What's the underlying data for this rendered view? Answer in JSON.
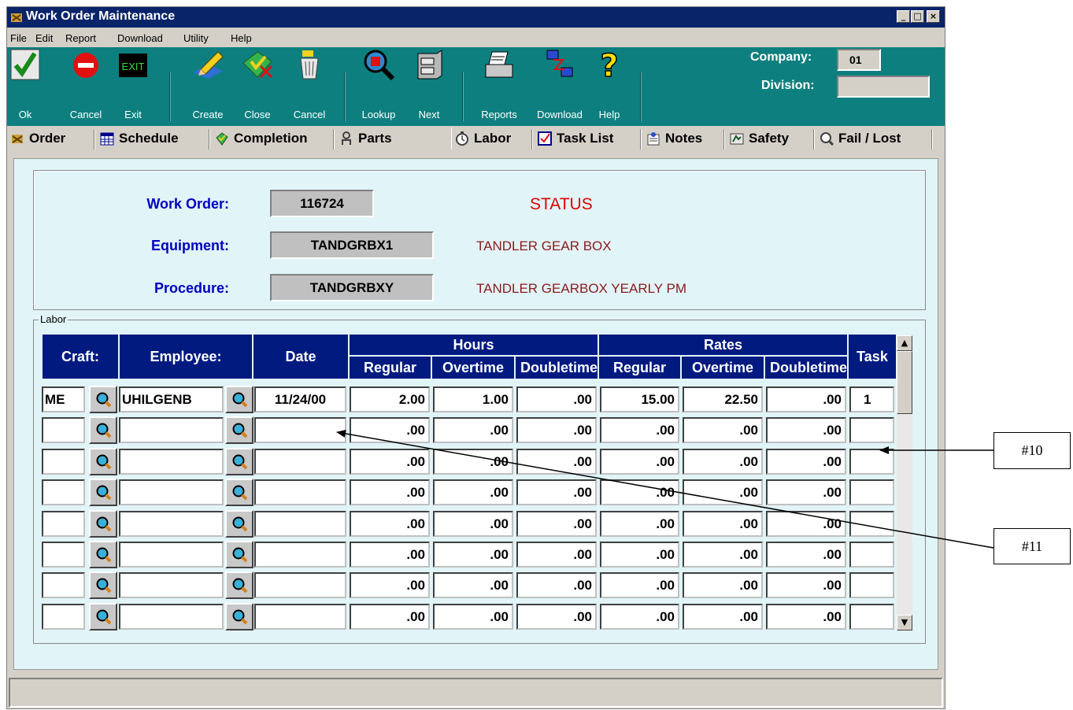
{
  "window": {
    "title": "Work Order Maintenance",
    "minimize": "_",
    "maximize": "□",
    "close": "×"
  },
  "menu": [
    "File",
    "Edit",
    "Report",
    "Download",
    "Utility",
    "Help"
  ],
  "toolbar": {
    "ok": "Ok",
    "cancel": "Cancel",
    "exit": "Exit",
    "exit_icon_text": "EXIT",
    "create": "Create",
    "close": "Close",
    "cancel2": "Cancel",
    "lookup": "Lookup",
    "next": "Next",
    "reports": "Reports",
    "download": "Download",
    "help": "Help",
    "company_label": "Company:",
    "company_value": "01",
    "division_label": "Division:",
    "division_value": ""
  },
  "tabs": [
    "Order",
    "Schedule",
    "Completion",
    "Parts",
    "Labor",
    "Task List",
    "Notes",
    "Safety",
    "Fail / Lost"
  ],
  "active_tab": "Labor",
  "header": {
    "work_order_label": "Work Order:",
    "work_order": "116724",
    "status": "STATUS",
    "equipment_label": "Equipment:",
    "equipment": "TANDGRBX1",
    "equipment_desc": "TANDLER GEAR BOX",
    "procedure_label": "Procedure:",
    "procedure": "TANDGRBXY",
    "procedure_desc": "TANDLER GEARBOX YEARLY PM"
  },
  "labor": {
    "group_title": "Labor",
    "headers": {
      "craft": "Craft:",
      "employee": "Employee:",
      "date": "Date",
      "task": "Task",
      "hours": "Hours",
      "rates": "Rates",
      "regular": "Regular",
      "overtime": "Overtime",
      "doubletime": "Doubletime"
    },
    "rows": [
      {
        "craft": "ME",
        "employee": "UHILGENB",
        "date": "11/24/00",
        "h_reg": "2.00",
        "h_ot": "1.00",
        "h_dt": ".00",
        "r_reg": "15.00",
        "r_ot": "22.50",
        "r_dt": ".00",
        "task": "1"
      },
      {
        "craft": "",
        "employee": "",
        "date": "",
        "h_reg": ".00",
        "h_ot": ".00",
        "h_dt": ".00",
        "r_reg": ".00",
        "r_ot": ".00",
        "r_dt": ".00",
        "task": ""
      },
      {
        "craft": "",
        "employee": "",
        "date": "",
        "h_reg": ".00",
        "h_ot": ".00",
        "h_dt": ".00",
        "r_reg": ".00",
        "r_ot": ".00",
        "r_dt": ".00",
        "task": ""
      },
      {
        "craft": "",
        "employee": "",
        "date": "",
        "h_reg": ".00",
        "h_ot": ".00",
        "h_dt": ".00",
        "r_reg": ".00",
        "r_ot": ".00",
        "r_dt": ".00",
        "task": ""
      },
      {
        "craft": "",
        "employee": "",
        "date": "",
        "h_reg": ".00",
        "h_ot": ".00",
        "h_dt": ".00",
        "r_reg": ".00",
        "r_ot": ".00",
        "r_dt": ".00",
        "task": ""
      },
      {
        "craft": "",
        "employee": "",
        "date": "",
        "h_reg": ".00",
        "h_ot": ".00",
        "h_dt": ".00",
        "r_reg": ".00",
        "r_ot": ".00",
        "r_dt": ".00",
        "task": ""
      },
      {
        "craft": "",
        "employee": "",
        "date": "",
        "h_reg": ".00",
        "h_ot": ".00",
        "h_dt": ".00",
        "r_reg": ".00",
        "r_ot": ".00",
        "r_dt": ".00",
        "task": ""
      },
      {
        "craft": "",
        "employee": "",
        "date": "",
        "h_reg": ".00",
        "h_ot": ".00",
        "h_dt": ".00",
        "r_reg": ".00",
        "r_ot": ".00",
        "r_dt": ".00",
        "task": ""
      }
    ]
  },
  "annotations": {
    "callout_10": "#10",
    "callout_11": "#11"
  },
  "colors": {
    "toolbar": "#0e7f7f",
    "title_bar": "#0a246a",
    "grid_header": "#001a80",
    "panel": "#e1f4f8",
    "label_blue": "#0000c0",
    "status_red": "#e00000",
    "desc_red": "#8b1a1a"
  }
}
